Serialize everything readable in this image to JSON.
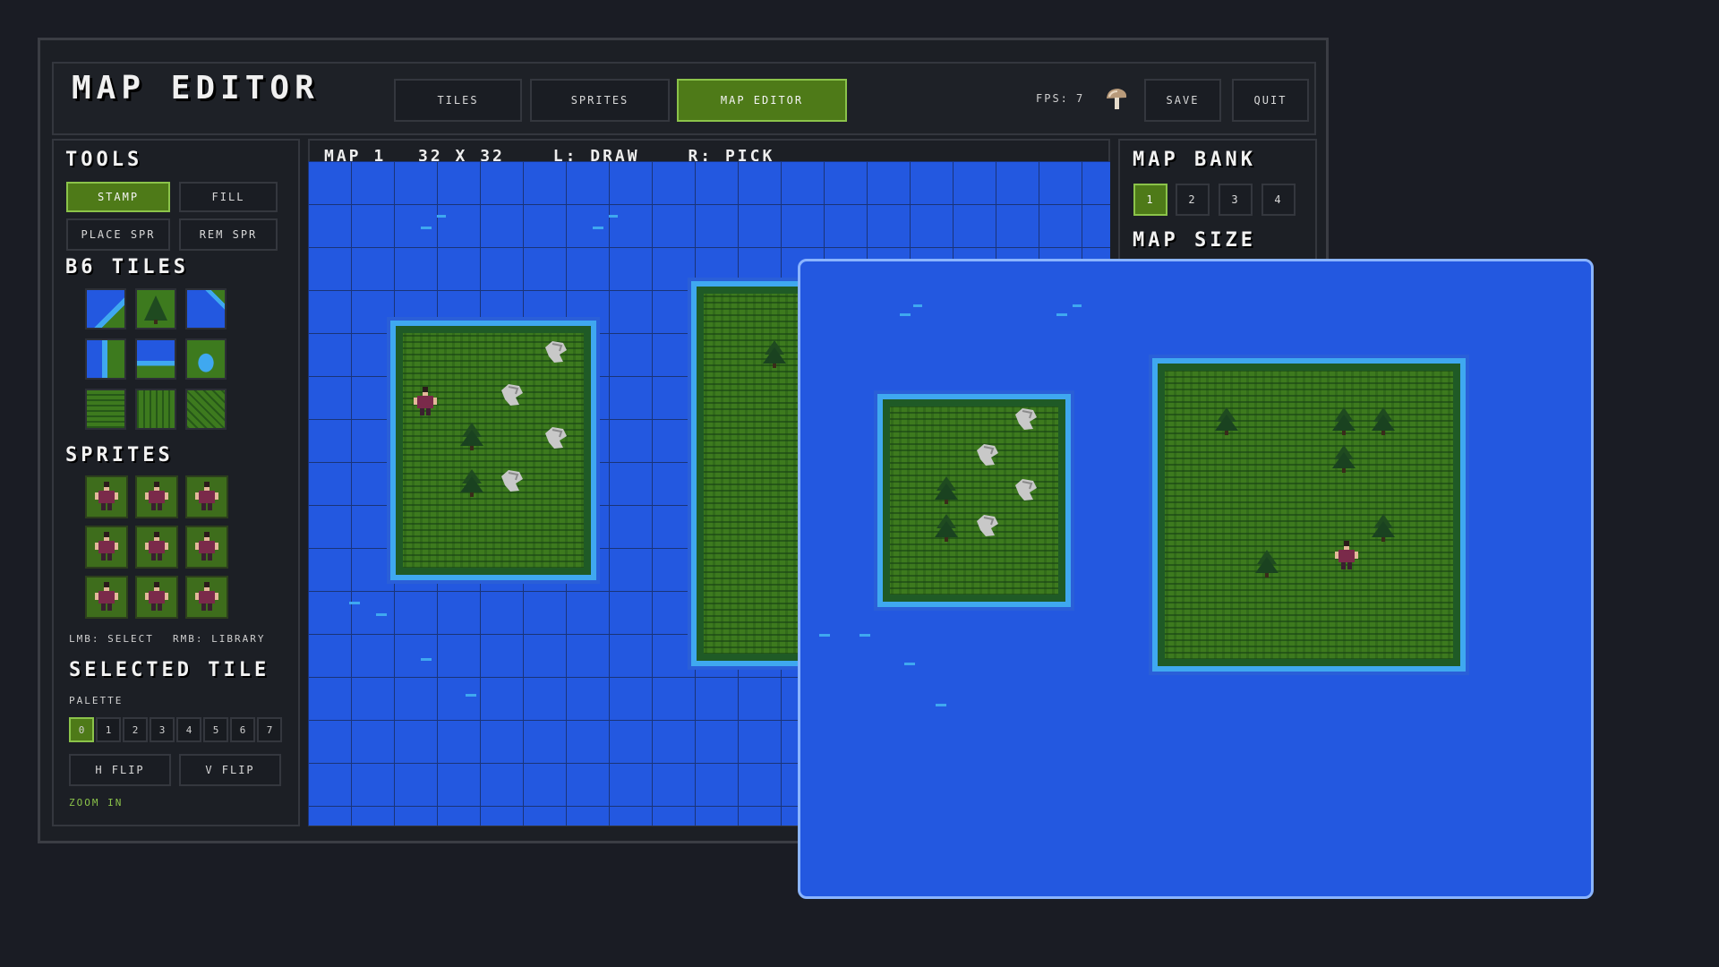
{
  "app": {
    "title": "MAP EDITOR"
  },
  "nav": {
    "tabs": [
      {
        "label": "TILES",
        "active": false
      },
      {
        "label": "SPRITES",
        "active": false
      },
      {
        "label": "MAP EDITOR",
        "active": true
      }
    ],
    "fps_label": "FPS:",
    "fps_value": "7",
    "save_label": "SAVE",
    "quit_label": "QUIT"
  },
  "tools": {
    "heading": "TOOLS",
    "stamp_label": "STAMP",
    "fill_label": "FILL",
    "place_spr_label": "PLACE SPR",
    "rem_spr_label": "REM SPR"
  },
  "tiles": {
    "heading": "B6 TILES"
  },
  "sprites": {
    "heading": "SPRITES",
    "hint_lmb": "LMB: SELECT",
    "hint_rmb": "RMB: LIBRARY"
  },
  "selected_tile": {
    "heading": "SELECTED TILE",
    "palette_label": "PALETTE",
    "palette": [
      "0",
      "1",
      "2",
      "3",
      "4",
      "5",
      "6",
      "7"
    ],
    "active_palette": "0",
    "hflip_label": "H FLIP",
    "vflip_label": "V FLIP",
    "zoom_label": "ZOOM IN"
  },
  "canvas": {
    "status_map": "MAP 1",
    "status_size": "32 X 32",
    "status_l": "L: DRAW",
    "status_r": "R: PICK"
  },
  "map_bank": {
    "heading": "MAP BANK",
    "items": [
      "1",
      "2",
      "3",
      "4"
    ],
    "active": "1",
    "size_heading": "MAP SIZE"
  },
  "colors": {
    "accent": "#4e7a18",
    "accent_border": "#8bc34a",
    "water": "#2358e0",
    "shore": "#3fa8f0",
    "grass": "#3d7a1e"
  },
  "icons": {
    "fps_icon": "mushroom-icon"
  }
}
